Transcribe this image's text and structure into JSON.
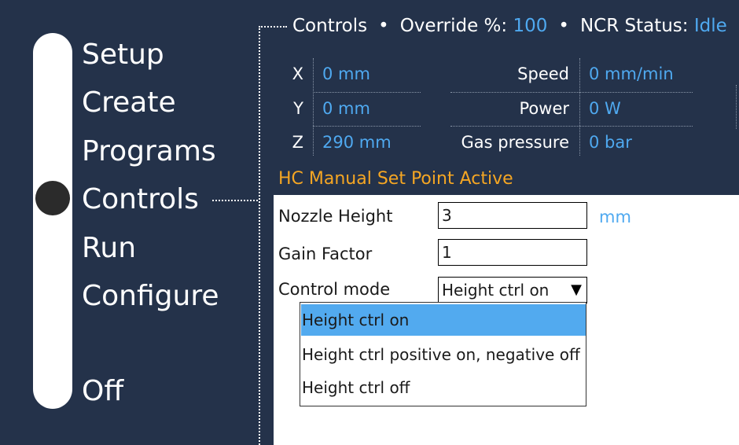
{
  "nav": {
    "items": [
      {
        "label": "Setup"
      },
      {
        "label": "Create"
      },
      {
        "label": "Programs"
      },
      {
        "label": "Controls"
      },
      {
        "label": "Run"
      },
      {
        "label": "Configure"
      },
      {
        "label": "Off"
      }
    ],
    "active": "Controls"
  },
  "status": {
    "section": "Controls",
    "override_label": "Override %:",
    "override_value": "100",
    "ncr_label": "NCR Status:",
    "ncr_value": "Idle",
    "separator": "•"
  },
  "readouts": {
    "x": {
      "label": "X",
      "value": "0 mm"
    },
    "y": {
      "label": "Y",
      "value": "0 mm"
    },
    "z": {
      "label": "Z",
      "value": "290 mm"
    },
    "speed": {
      "label": "Speed",
      "value": "0 mm/min"
    },
    "power": {
      "label": "Power",
      "value": "0 W"
    },
    "gas": {
      "label": "Gas pressure",
      "value": "0 bar"
    }
  },
  "hc": {
    "title": "HC Manual Set Point Active",
    "nozzle_label": "Nozzle Height",
    "nozzle_value": "3",
    "nozzle_unit": "mm",
    "gain_label": "Gain Factor",
    "gain_value": "1",
    "mode_label": "Control mode",
    "mode_selected": "Height ctrl on",
    "mode_arrow": "▼",
    "mode_options": [
      {
        "label": "Height ctrl on"
      },
      {
        "label": "Height ctrl positive on, negative off"
      },
      {
        "label": "Height ctrl off"
      }
    ]
  },
  "colors": {
    "background": "#24324a",
    "accent": "#4fa9f0",
    "warning": "#f5a623",
    "selection": "#52aaef"
  }
}
